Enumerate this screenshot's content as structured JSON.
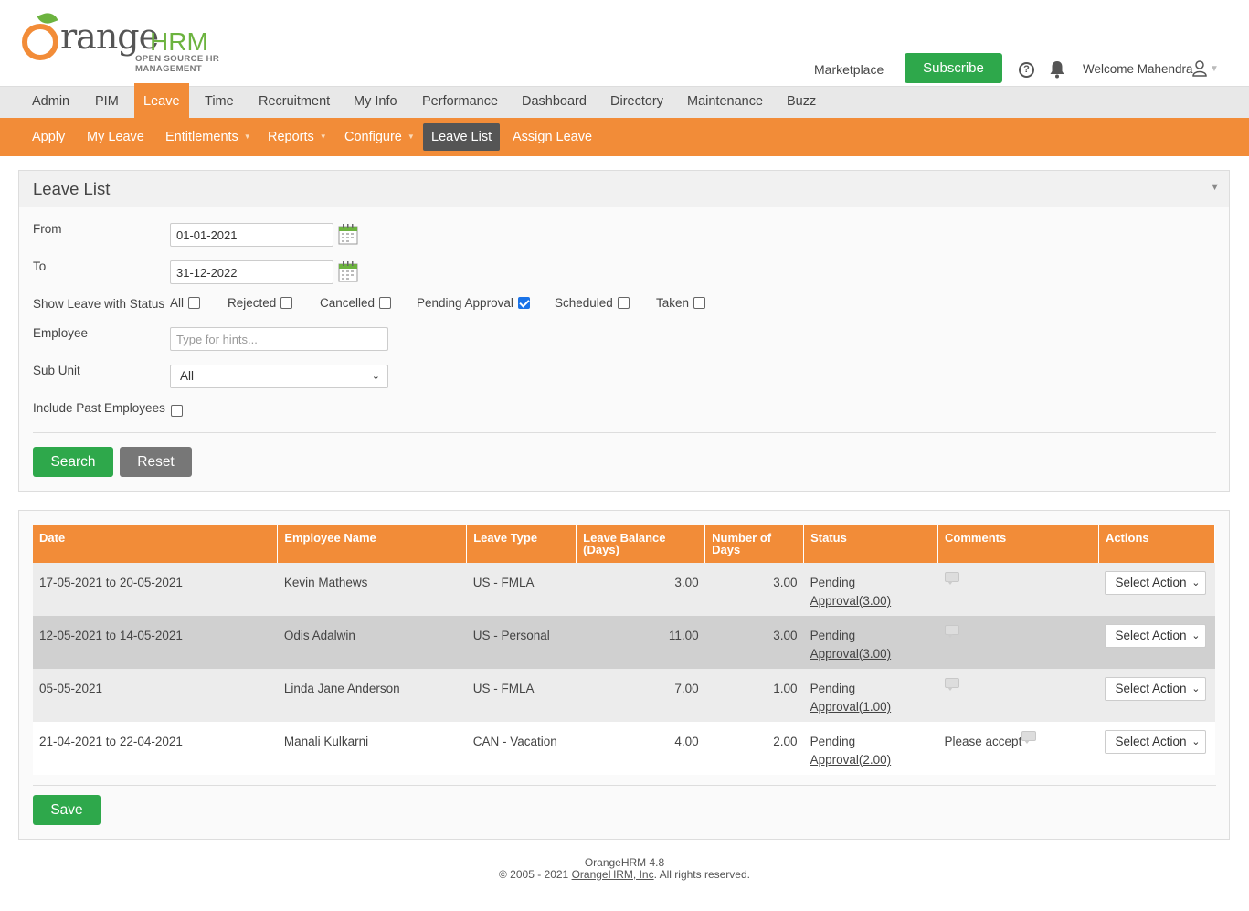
{
  "logo": {
    "word": "range",
    "hrm": "HRM",
    "tagline": "OPEN SOURCE HR MANAGEMENT"
  },
  "header": {
    "marketplace": "Marketplace",
    "subscribe": "Subscribe",
    "welcome": "Welcome Mahendra"
  },
  "mainnav": [
    "Admin",
    "PIM",
    "Leave",
    "Time",
    "Recruitment",
    "My Info",
    "Performance",
    "Dashboard",
    "Directory",
    "Maintenance",
    "Buzz"
  ],
  "subnav": {
    "apply": "Apply",
    "my_leave": "My Leave",
    "entitlements": "Entitlements",
    "reports": "Reports",
    "configure": "Configure",
    "leave_list": "Leave List",
    "assign_leave": "Assign Leave"
  },
  "filter": {
    "title": "Leave List",
    "from_label": "From",
    "from_value": "01-01-2021",
    "to_label": "To",
    "to_value": "31-12-2022",
    "status_label": "Show Leave with Status",
    "statuses": [
      {
        "label": "All",
        "checked": false
      },
      {
        "label": "Rejected",
        "checked": false
      },
      {
        "label": "Cancelled",
        "checked": false
      },
      {
        "label": "Pending Approval",
        "checked": true
      },
      {
        "label": "Scheduled",
        "checked": false
      },
      {
        "label": "Taken",
        "checked": false
      }
    ],
    "employee_label": "Employee",
    "employee_placeholder": "Type for hints...",
    "subunit_label": "Sub Unit",
    "subunit_value": "All",
    "past_label": "Include Past Employees",
    "search": "Search",
    "reset": "Reset"
  },
  "table": {
    "headers": {
      "date": "Date",
      "employee": "Employee Name",
      "type": "Leave Type",
      "balance": "Leave Balance (Days)",
      "days": "Number of Days",
      "status": "Status",
      "comments": "Comments",
      "actions": "Actions"
    },
    "rows": [
      {
        "date": "17-05-2021 to 20-05-2021",
        "employee": "Kevin Mathews",
        "type": "US - FMLA",
        "balance": "3.00",
        "days": "3.00",
        "status1": "Pending",
        "status2": "Approval(3.00)",
        "comment": "",
        "action": "Select Action"
      },
      {
        "date": "12-05-2021 to 14-05-2021",
        "employee": "Odis Adalwin",
        "type": "US - Personal",
        "balance": "11.00",
        "days": "3.00",
        "status1": "Pending",
        "status2": "Approval(3.00)",
        "comment": "",
        "action": "Select Action"
      },
      {
        "date": "05-05-2021",
        "employee": "Linda Jane Anderson",
        "type": "US - FMLA",
        "balance": "7.00",
        "days": "1.00",
        "status1": "Pending",
        "status2": "Approval(1.00)",
        "comment": "",
        "action": "Select Action"
      },
      {
        "date": "21-04-2021 to 22-04-2021",
        "employee": "Manali Kulkarni",
        "type": "CAN - Vacation",
        "balance": "4.00",
        "days": "2.00",
        "status1": "Pending",
        "status2": "Approval(2.00)",
        "comment": "Please accept",
        "action": "Select Action"
      }
    ],
    "save": "Save"
  },
  "footer": {
    "version": "OrangeHRM 4.8",
    "copy_prefix": "© 2005 - 2021 ",
    "company": "OrangeHRM, Inc",
    "copy_suffix": ". All rights reserved."
  },
  "colors": {
    "accent": "#f28c38",
    "green": "#2ea84b",
    "leaf": "#6cb33f"
  }
}
